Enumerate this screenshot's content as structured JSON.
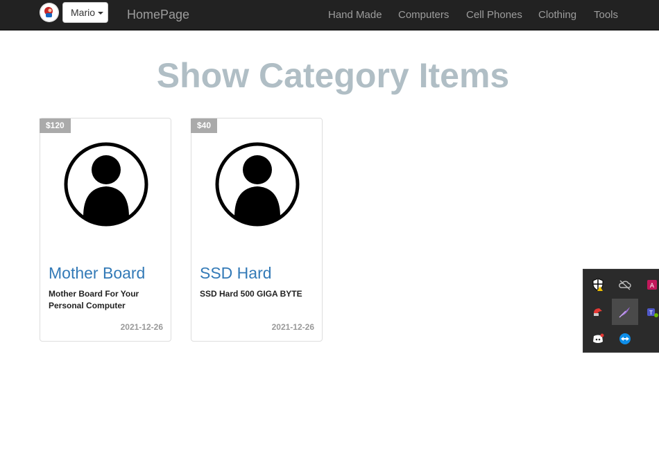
{
  "nav": {
    "user_label": "Mario",
    "brand": "HomePage",
    "links": [
      "Hand Made",
      "Computers",
      "Cell Phones",
      "Clothing",
      "Tools"
    ]
  },
  "page": {
    "title": "Show Category Items"
  },
  "items": [
    {
      "price": "$120",
      "title": "Mother Board",
      "description": "Mother Board For Your Personal Computer",
      "date": "2021-12-26"
    },
    {
      "price": "$40",
      "title": "SSD Hard",
      "description": "SSD Hard 500 GIGA BYTE",
      "date": "2021-12-26"
    }
  ],
  "tray_icons": [
    "defender-icon",
    "onedrive-icon",
    "app-icon",
    "cleaner-icon",
    "feather-icon",
    "teams-icon",
    "discord-icon",
    "teamviewer-icon"
  ],
  "colors": {
    "navbar": "#222222",
    "title": "#b0bec5",
    "link": "#337ab7",
    "price_badge": "#aaaaaa"
  }
}
